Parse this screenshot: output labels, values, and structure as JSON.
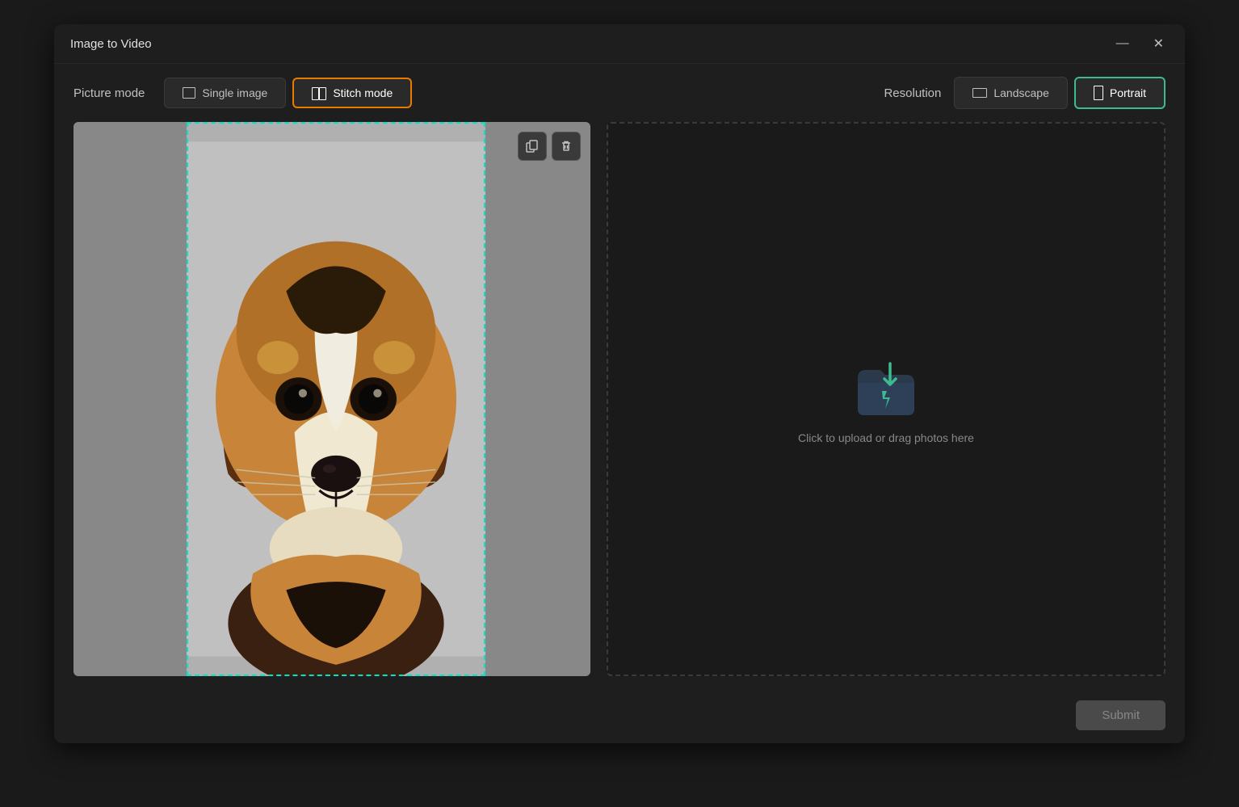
{
  "window": {
    "title": "Image to Video",
    "minimize_label": "—",
    "close_label": "✕"
  },
  "picture_mode": {
    "label": "Picture mode",
    "buttons": [
      {
        "id": "single",
        "label": "Single image",
        "active": false
      },
      {
        "id": "stitch",
        "label": "Stitch mode",
        "active": true
      }
    ]
  },
  "resolution": {
    "label": "Resolution",
    "buttons": [
      {
        "id": "landscape",
        "label": "Landscape",
        "active": false
      },
      {
        "id": "portrait",
        "label": "Portrait",
        "active": true
      }
    ]
  },
  "upload_area": {
    "text": "Click to upload or drag photos here"
  },
  "actions": {
    "duplicate_icon": "⧉",
    "delete_icon": "🗑"
  },
  "footer": {
    "submit_label": "Submit"
  }
}
